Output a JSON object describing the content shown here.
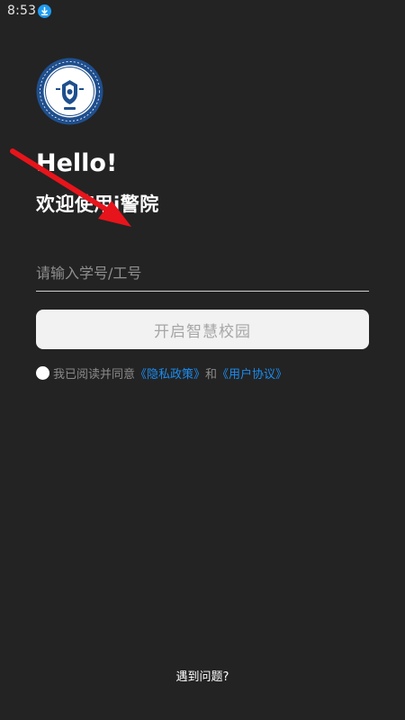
{
  "status_bar": {
    "time": "8:53",
    "notification_icon": "download-icon",
    "badge_color": "#1e9bf0"
  },
  "logo": {
    "icon": "police-academy-seal",
    "ring_color": "#1f4f8e",
    "emblem_number": "1954"
  },
  "greeting": {
    "hello": "Hello!",
    "welcome": "欢迎使用i警院"
  },
  "login": {
    "id_placeholder": "请输入学号/工号",
    "id_value": "",
    "start_button": "开启智慧校园"
  },
  "agreement": {
    "checked": false,
    "prefix": "我已阅读并同意",
    "privacy_link": "《隐私政策》",
    "conjunction": "和",
    "terms_link": "《用户协议》",
    "link_color": "#1a8cf0"
  },
  "footer": {
    "help": "遇到问题?"
  },
  "annotation": {
    "arrow_color": "#e8141b"
  }
}
